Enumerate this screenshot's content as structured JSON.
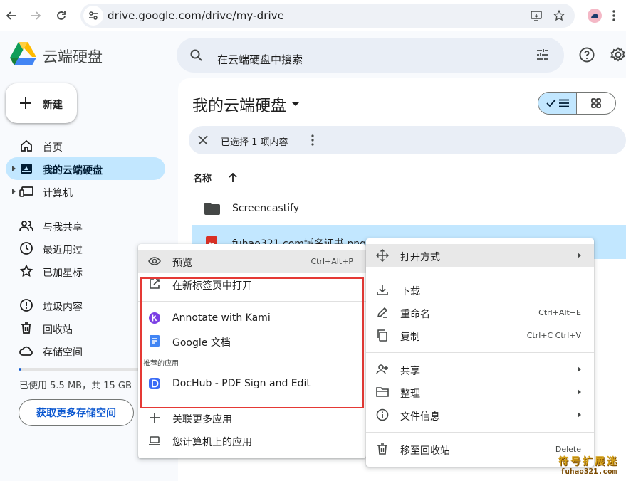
{
  "browser": {
    "url": "drive.google.com/drive/my-drive"
  },
  "app": {
    "title": "云端硬盘",
    "search_placeholder": "在云端硬盘中搜索"
  },
  "sidebar": {
    "new_label": "新建",
    "items": [
      {
        "label": "首页"
      },
      {
        "label": "我的云端硬盘"
      },
      {
        "label": "计算机"
      },
      {
        "label": "与我共享"
      },
      {
        "label": "最近用过"
      },
      {
        "label": "已加星标"
      },
      {
        "label": "垃圾内容"
      },
      {
        "label": "回收站"
      },
      {
        "label": "存储空间"
      }
    ],
    "storage_used_fraction": 0.0004,
    "storage_text": "已使用 5.5 MB，共 15 GB",
    "get_more": "获取更多存储空间"
  },
  "main": {
    "title": "我的云端硬盘",
    "selection_text": "已选择 1 项内容",
    "column_name": "名称",
    "files": [
      {
        "name": "Screencastify",
        "type": "folder"
      },
      {
        "name": "fuhao321.com域名证书.png",
        "type": "image"
      }
    ]
  },
  "open_with_menu": {
    "items": [
      {
        "label": "预览",
        "shortcut": "Ctrl+Alt+P"
      },
      {
        "label": "在新标签页中打开"
      },
      {
        "label": "Annotate with Kami"
      },
      {
        "label": "Google 文档"
      },
      {
        "label": "DocHub - PDF Sign and Edit"
      },
      {
        "label": "关联更多应用"
      },
      {
        "label": "您计算机上的应用"
      }
    ],
    "section_label": "推荐的应用"
  },
  "context_menu": {
    "items": [
      {
        "label": "打开方式"
      },
      {
        "label": "下载"
      },
      {
        "label": "重命名",
        "shortcut": "Ctrl+Alt+E"
      },
      {
        "label": "复制",
        "shortcut": "Ctrl+C Ctrl+V"
      },
      {
        "label": "共享"
      },
      {
        "label": "整理"
      },
      {
        "label": "文件信息"
      },
      {
        "label": "移至回收站",
        "shortcut": "Delete"
      }
    ]
  },
  "watermark": {
    "cn": "符号扩展迷",
    "en": "fuhao321.com"
  },
  "colors": {
    "accent": "#0b57d0",
    "selected": "#c2e7ff",
    "highlight_box": "#e53935"
  }
}
